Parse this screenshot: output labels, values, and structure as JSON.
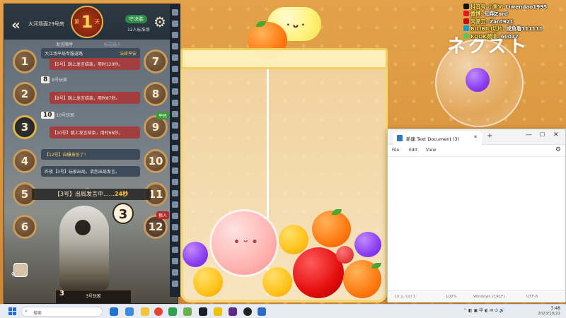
{
  "overlay": {
    "bubble_text": "ネクスト",
    "social": [
      {
        "label": "抖音号-小鱼V:",
        "value": "Liwendao1995",
        "color": "#000000"
      },
      {
        "label": "微博:",
        "value": "知翔Zard",
        "color": "#e6162d"
      },
      {
        "label": "网易云:",
        "value": "Zard921",
        "color": "#c20c0c"
      },
      {
        "label": "BILIBILI切片:",
        "value": "咸鱼看111111",
        "color": "#00a1d6"
      },
      {
        "label": "KOOK频道:",
        "value": "60037",
        "color": "#5ac85a"
      }
    ]
  },
  "werewolf": {
    "room": "大河场面29号房",
    "day_prefix": "第",
    "day_number": "1",
    "day_suffix": "天",
    "mode": "守决胜",
    "players": "12人标准场",
    "tabs": [
      "发言顺序",
      "标记选人"
    ],
    "seats_left": [
      "1",
      "2",
      "3",
      "4",
      "5",
      "6"
    ],
    "seats_right": [
      "7",
      "8",
      "9",
      "10",
      "11",
      "12"
    ],
    "badges": {
      "seat9": "平民",
      "seat12": "狼人"
    },
    "chat": {
      "sys1": "大江场平局专服道路",
      "sys1_tag": "法官平安",
      "m1_num": "",
      "m1_text": "【5号】跳上发言结束，用时120秒。",
      "m2_num": "8",
      "m2_head": "8号玩家",
      "m2_text": "【8号】跳上发言结束，用时87秒。",
      "m3_num": "10",
      "m3_head": "10号玩家",
      "m3_text": "【10号】跳上发言结束，用时66秒。",
      "sys2": "【12号】自爆身份了！",
      "sys3": "昨夜【3号】玩家出局，请您出局发言。"
    },
    "speaking_prefix": "【3号】出局发言中……",
    "speaking_seconds": "24秒",
    "speaker_number": "3",
    "bottom_title": "3号玩家",
    "bottom_sub": "",
    "bottom_seat": "3",
    "small_avatar_num": "9"
  },
  "notepad": {
    "title": "新建 Text Document (3)",
    "menu": [
      "File",
      "Edit",
      "View"
    ],
    "content": "",
    "status": [
      "Ln 1, Col 1",
      "100%",
      "Windows (CRLF)",
      "UTF-8"
    ]
  },
  "taskbar": {
    "search_placeholder": "搜索",
    "time": "3:48",
    "date": "2023/10/22"
  }
}
